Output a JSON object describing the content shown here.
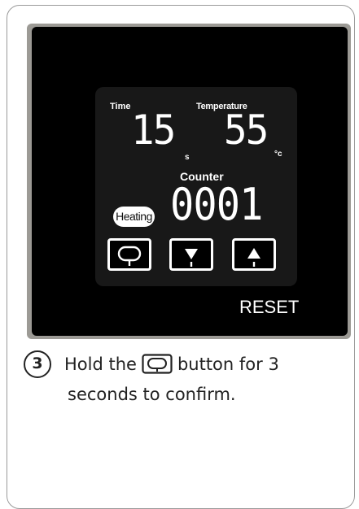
{
  "panel": {
    "time_label": "Time",
    "temperature_label": "Temperature",
    "time_value": "15",
    "time_unit": "s",
    "temperature_value": "55",
    "temperature_unit": "°c",
    "counter_label": "Counter",
    "counter_value": "0001",
    "status_badge": "Heating",
    "buttons": [
      {
        "name": "cycle-button",
        "icon": "cycle-arrow-icon"
      },
      {
        "name": "down-button",
        "icon": "triangle-down-icon"
      },
      {
        "name": "up-button",
        "icon": "triangle-up-icon"
      }
    ],
    "reset_label": "RESET"
  },
  "instruction": {
    "step_number": "3",
    "text_before_icon": "Hold the",
    "icon": "cycle-arrow-icon",
    "text_after_icon": "button for 3",
    "text_line2": "seconds to confirm."
  },
  "colors": {
    "device_bezel": "#9c9a95",
    "device_face": "#000000",
    "lcd_background": "#181818",
    "segment_white": "#ffffff",
    "text": "#222222"
  }
}
